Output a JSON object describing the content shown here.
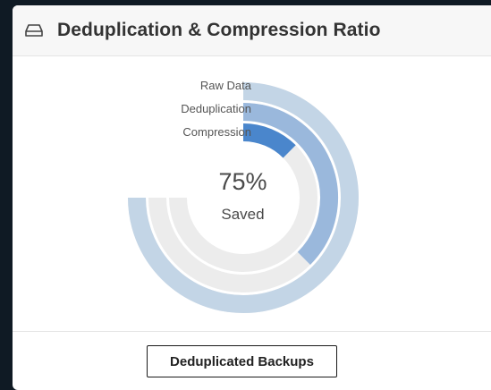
{
  "card": {
    "title": "Deduplication & Compression Ratio",
    "icon": "hdd-drive-icon"
  },
  "chart_data": {
    "type": "radial-bar",
    "center": {
      "value": "75%",
      "label": "Saved"
    },
    "series": [
      {
        "name": "Raw Data",
        "value": 0.75,
        "color": "#c3d5e6"
      },
      {
        "name": "Deduplication",
        "value": 0.375,
        "color": "#9ab8dc"
      },
      {
        "name": "Compression",
        "value": 0.125,
        "color": "#4a86cc"
      }
    ],
    "track_color": "#ececec"
  },
  "legend": {
    "button_label": "Deduplicated Backups"
  }
}
